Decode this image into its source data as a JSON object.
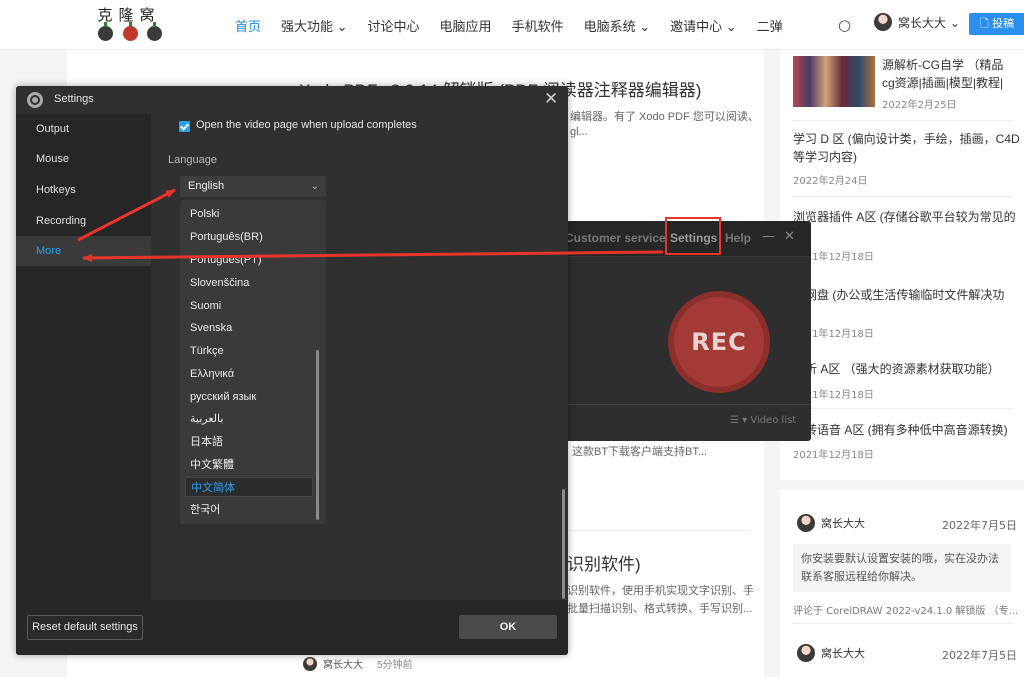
{
  "site": {
    "logo_text": "克隆窝",
    "nav": [
      "首页",
      "强大功能 ⌄",
      "讨论中心",
      "电脑应用",
      "手机软件",
      "电脑系统 ⌄",
      "邀请中心 ⌄",
      "二弹"
    ],
    "user_name": "窝长大大 ⌄",
    "post_button": "🗋 投稿",
    "accent_color": "#1e88e5"
  },
  "main": {
    "article1_title": "Xodo PDF v8.0.14 解锁版 (PDF 阅读器注释器编辑器)",
    "article1_excerpt_1": "编辑器。有了 Xodo PDF 您可以阅读、",
    "article1_excerpt_2": "gl...",
    "article2_excerpt": "这款BT下载客户端支持BT...",
    "article3_title": "识别软件)",
    "article3_excerpt_1": "识别软件，使用手机实现文字识别、手",
    "article3_excerpt_2": "批量扫描识别、格式转换、手写识别...",
    "footer_author": "窝长大大",
    "footer_time": "5分钟前"
  },
  "sidebar": {
    "items": [
      {
        "title": "源解析-CG自学 （精品cg资源|插画|模型|教程|影...",
        "date": "2022年2月25日"
      },
      {
        "title": "学习 D 区 (偏向设计类，手绘，插画，C4D 等学习内容)",
        "date": "2022年2月24日"
      },
      {
        "title": "浏览器插件 A区 (存储谷歌平台较为常见的件)",
        "date": "2021年12月18日"
      },
      {
        "title": "时网盘 (办公或生活传输临时文件解决功",
        "date": "2021年12月18日"
      },
      {
        "title": "解析 A区 （强大的资源素材获取功能）",
        "date": "2021年12月18日"
      },
      {
        "title": "字转语音 A区 (拥有多种低中高音源转换)",
        "date": "2021年12月18日"
      }
    ],
    "comments": [
      {
        "user": "窝长大大",
        "date": "2022年7月5日",
        "text": "你安装要默认设置安装的哦，实在没办法联系客服远程给你解决。",
        "ref": "评论于 CorelDRAW 2022-v24.1.0 解锁版 （专..."
      },
      {
        "user": "窝长大大",
        "date": "2022年7月5日"
      }
    ]
  },
  "recorder": {
    "customer_service": "Customer service",
    "settings": "Settings",
    "help": "Help",
    "minimize": "—",
    "close": "✕",
    "rec_label": "REC",
    "video_list": "☰ ▾  Video list",
    "rec_color": "#a33a36"
  },
  "settings_dialog": {
    "title": "Settings",
    "close": "✕",
    "nav": [
      "Output",
      "Mouse",
      "Hotkeys",
      "Recording",
      "More"
    ],
    "active_nav": "More",
    "checkbox_label": "Open the video page when upload completes",
    "checkbox_checked": true,
    "language_label": "Language",
    "language_selected": "English",
    "language_options": [
      "Polski",
      "Português(BR)",
      "Portugues(PT)",
      "Slovenščina",
      "Suomi",
      "Svenska",
      "Türkçe",
      "Ελληνικά",
      "русский язык",
      "بالعربية",
      "日本語",
      "中文繁體",
      "中文简体",
      "한국어"
    ],
    "language_highlighted": "中文简体",
    "reset_button": "Reset default settings",
    "ok_button": "OK",
    "accent_color": "#2ea0e8"
  },
  "annotations": {
    "arrow_color": "#e8352b"
  }
}
